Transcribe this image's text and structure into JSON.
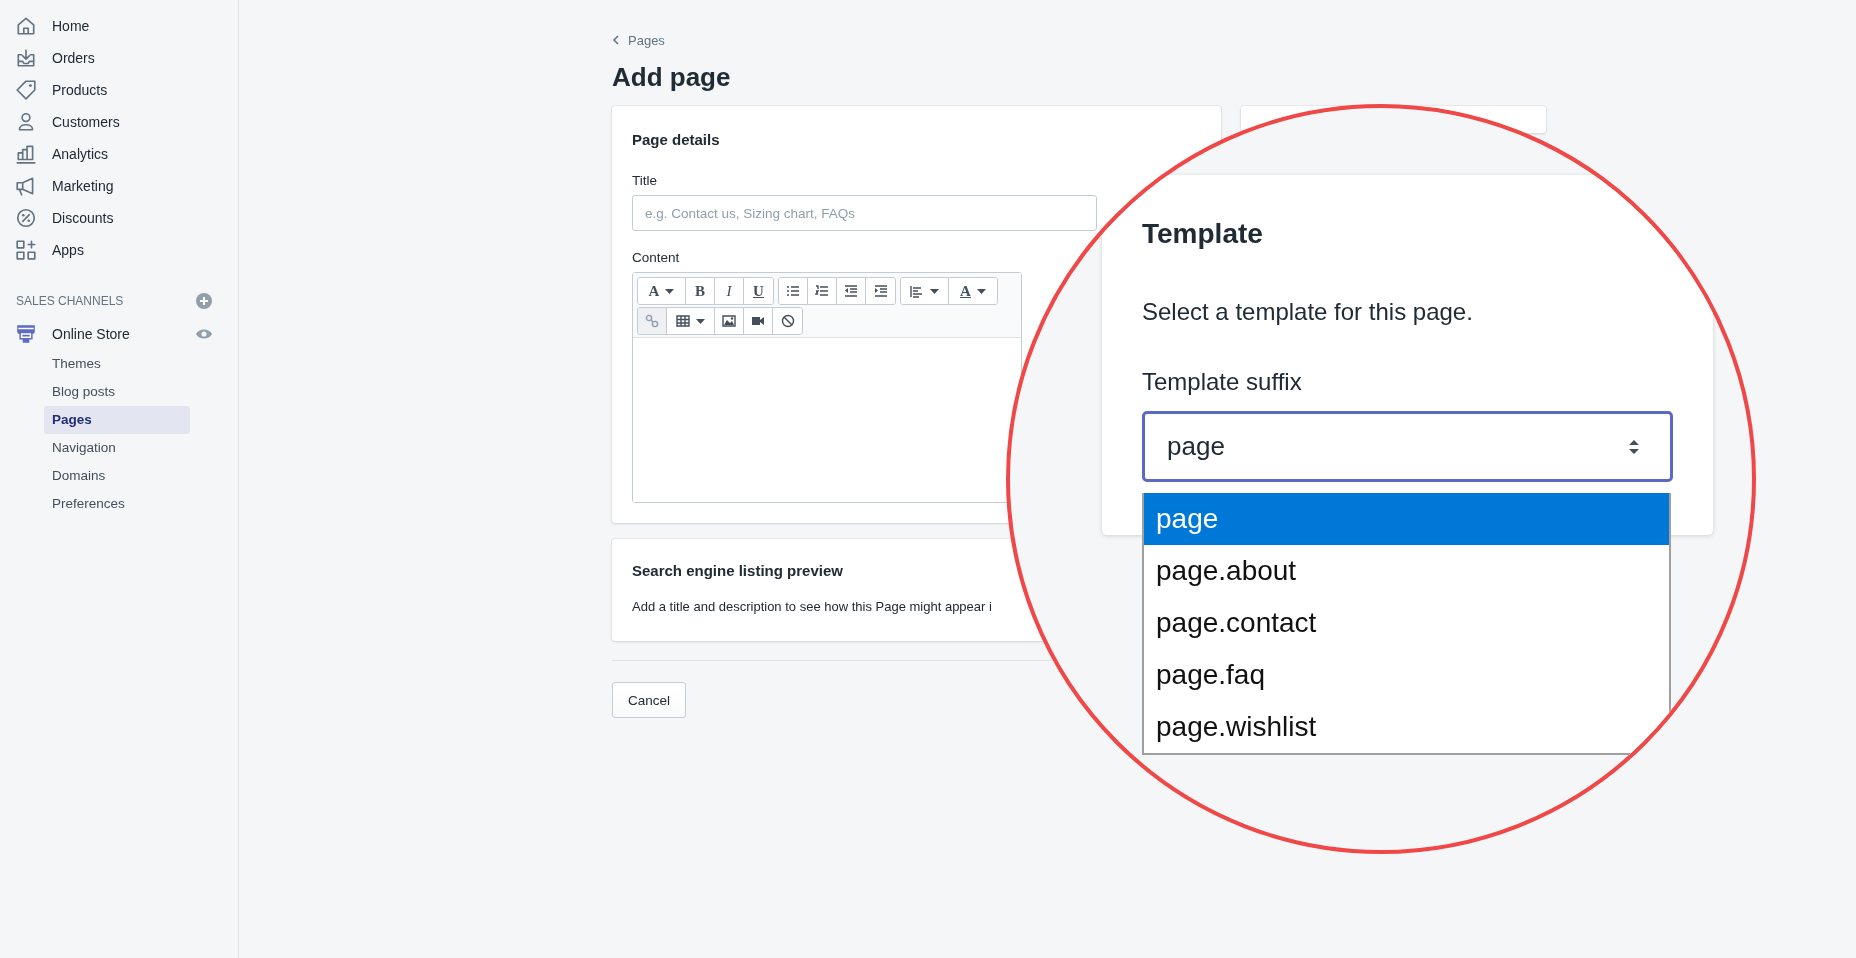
{
  "sidebar": {
    "nav": [
      {
        "label": "Home",
        "selected": false
      },
      {
        "label": "Orders",
        "selected": false
      },
      {
        "label": "Products",
        "selected": false
      },
      {
        "label": "Customers",
        "selected": false
      },
      {
        "label": "Analytics",
        "selected": false
      },
      {
        "label": "Marketing",
        "selected": false
      },
      {
        "label": "Discounts",
        "selected": false
      },
      {
        "label": "Apps",
        "selected": false
      }
    ],
    "section_title": "SALES CHANNELS",
    "channel": {
      "label": "Online Store"
    },
    "subitems": [
      {
        "label": "Themes",
        "selected": false
      },
      {
        "label": "Blog posts",
        "selected": false
      },
      {
        "label": "Pages",
        "selected": true
      },
      {
        "label": "Navigation",
        "selected": false
      },
      {
        "label": "Domains",
        "selected": false
      },
      {
        "label": "Preferences",
        "selected": false
      }
    ]
  },
  "breadcrumb": "Pages",
  "page_title": "Add page",
  "page_details": {
    "heading": "Page details",
    "title_label": "Title",
    "title_placeholder": "e.g. Contact us, Sizing chart, FAQs",
    "content_label": "Content",
    "toolbar": [
      [
        [
          {
            "kind": "font",
            "label": "A",
            "caret": true,
            "disabled": false
          },
          {
            "kind": "bold",
            "label": "B",
            "caret": false,
            "disabled": false
          },
          {
            "kind": "italic",
            "label": "I",
            "caret": false,
            "disabled": false
          },
          {
            "kind": "underline",
            "label": "U",
            "caret": false,
            "disabled": false
          }
        ],
        [
          {
            "kind": "bullets",
            "caret": false,
            "disabled": false
          },
          {
            "kind": "numbers",
            "caret": false,
            "disabled": false
          },
          {
            "kind": "outdent",
            "caret": false,
            "disabled": false
          },
          {
            "kind": "indent",
            "caret": false,
            "disabled": false
          }
        ],
        [
          {
            "kind": "align",
            "caret": true,
            "disabled": false
          },
          {
            "kind": "color",
            "label": "A",
            "caret": true,
            "disabled": false
          }
        ]
      ],
      [
        [
          {
            "kind": "link",
            "caret": false,
            "disabled": true
          },
          {
            "kind": "table",
            "caret": true,
            "disabled": false
          },
          {
            "kind": "image",
            "caret": false,
            "disabled": false
          },
          {
            "kind": "video",
            "caret": false,
            "disabled": false
          },
          {
            "kind": "clear",
            "caret": false,
            "disabled": false
          }
        ]
      ]
    ]
  },
  "seo": {
    "heading": "Search engine listing preview",
    "text": "Add a title and description to see how this Page might appear i"
  },
  "cancel_button": "Cancel",
  "magnifier": {
    "heading": "Template",
    "text": "Select a template for this page.",
    "suffix_label": "Template suffix",
    "select_value": "page",
    "options": [
      {
        "label": "page",
        "selected": true
      },
      {
        "label": "page.about",
        "selected": false
      },
      {
        "label": "page.contact",
        "selected": false
      },
      {
        "label": "page.faq",
        "selected": false
      },
      {
        "label": "page.wishlist",
        "selected": false
      }
    ]
  }
}
